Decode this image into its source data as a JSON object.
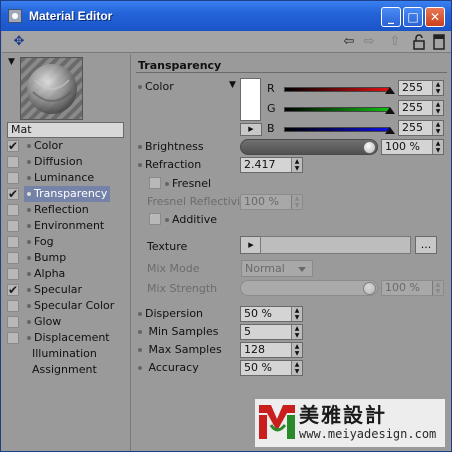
{
  "window": {
    "title": "Material Editor"
  },
  "titlebar": {
    "minimize": "_",
    "maximize": "□",
    "close": "✕"
  },
  "toolbar": {
    "icons": [
      "pin-icon",
      "back-arrow-icon",
      "forward-arrow-icon",
      "up-arrow-icon",
      "lock-icon",
      "panel-icon"
    ]
  },
  "material": {
    "name": "Mat"
  },
  "channels": [
    {
      "label": "Color",
      "checked": true,
      "dot": true
    },
    {
      "label": "Diffusion",
      "checked": false,
      "dot": true
    },
    {
      "label": "Luminance",
      "checked": false,
      "dot": true
    },
    {
      "label": "Transparency",
      "checked": true,
      "dot": true,
      "selected": true
    },
    {
      "label": "Reflection",
      "checked": false,
      "dot": true
    },
    {
      "label": "Environment",
      "checked": false,
      "dot": true
    },
    {
      "label": "Fog",
      "checked": false,
      "dot": true
    },
    {
      "label": "Bump",
      "checked": false,
      "dot": true
    },
    {
      "label": "Alpha",
      "checked": false,
      "dot": true
    },
    {
      "label": "Specular",
      "checked": true,
      "dot": true
    },
    {
      "label": "Specular Color",
      "checked": false,
      "dot": true
    },
    {
      "label": "Glow",
      "checked": false,
      "dot": true
    },
    {
      "label": "Displacement",
      "checked": false,
      "dot": true
    },
    {
      "label": "Illumination",
      "checked": null,
      "dot": false
    },
    {
      "label": "Assignment",
      "checked": null,
      "dot": false
    }
  ],
  "panel": {
    "title": "Transparency",
    "color": {
      "label": "Color",
      "swatch": "#ffffff",
      "r_label": "R",
      "r_value": "255",
      "g_label": "G",
      "g_value": "255",
      "b_label": "B",
      "b_value": "255"
    },
    "brightness": {
      "label": "Brightness",
      "value": "100 %",
      "level": 1.0
    },
    "refraction": {
      "label": "Refraction",
      "value": "2.417"
    },
    "fresnel": {
      "label": "Fresnel",
      "checked": false
    },
    "fresnel_reflectivity": {
      "label": "Fresnel Reflectivity",
      "value": "100 %"
    },
    "additive": {
      "label": "Additive",
      "checked": false
    },
    "texture": {
      "label": "Texture",
      "button": "..."
    },
    "mix_mode": {
      "label": "Mix Mode",
      "value": "Normal"
    },
    "mix_strength": {
      "label": "Mix Strength",
      "value": "100 %",
      "level": 1.0
    },
    "dispersion": {
      "label": "Dispersion",
      "value": "50 %"
    },
    "min_samples": {
      "label": "Min Samples",
      "value": "5"
    },
    "max_samples": {
      "label": "Max Samples",
      "value": "128"
    },
    "accuracy": {
      "label": "Accuracy",
      "value": "50 %"
    }
  },
  "watermark": {
    "text_cn": "美雅設計",
    "url": "www.meiyadesign.com"
  },
  "colors": {
    "titlebar": "#2464d8",
    "panel_bg": "#9a9a9a",
    "selection": "#7482a8",
    "red_channel": "#e01010",
    "green_channel": "#10c010",
    "blue_channel": "#1010e0"
  }
}
